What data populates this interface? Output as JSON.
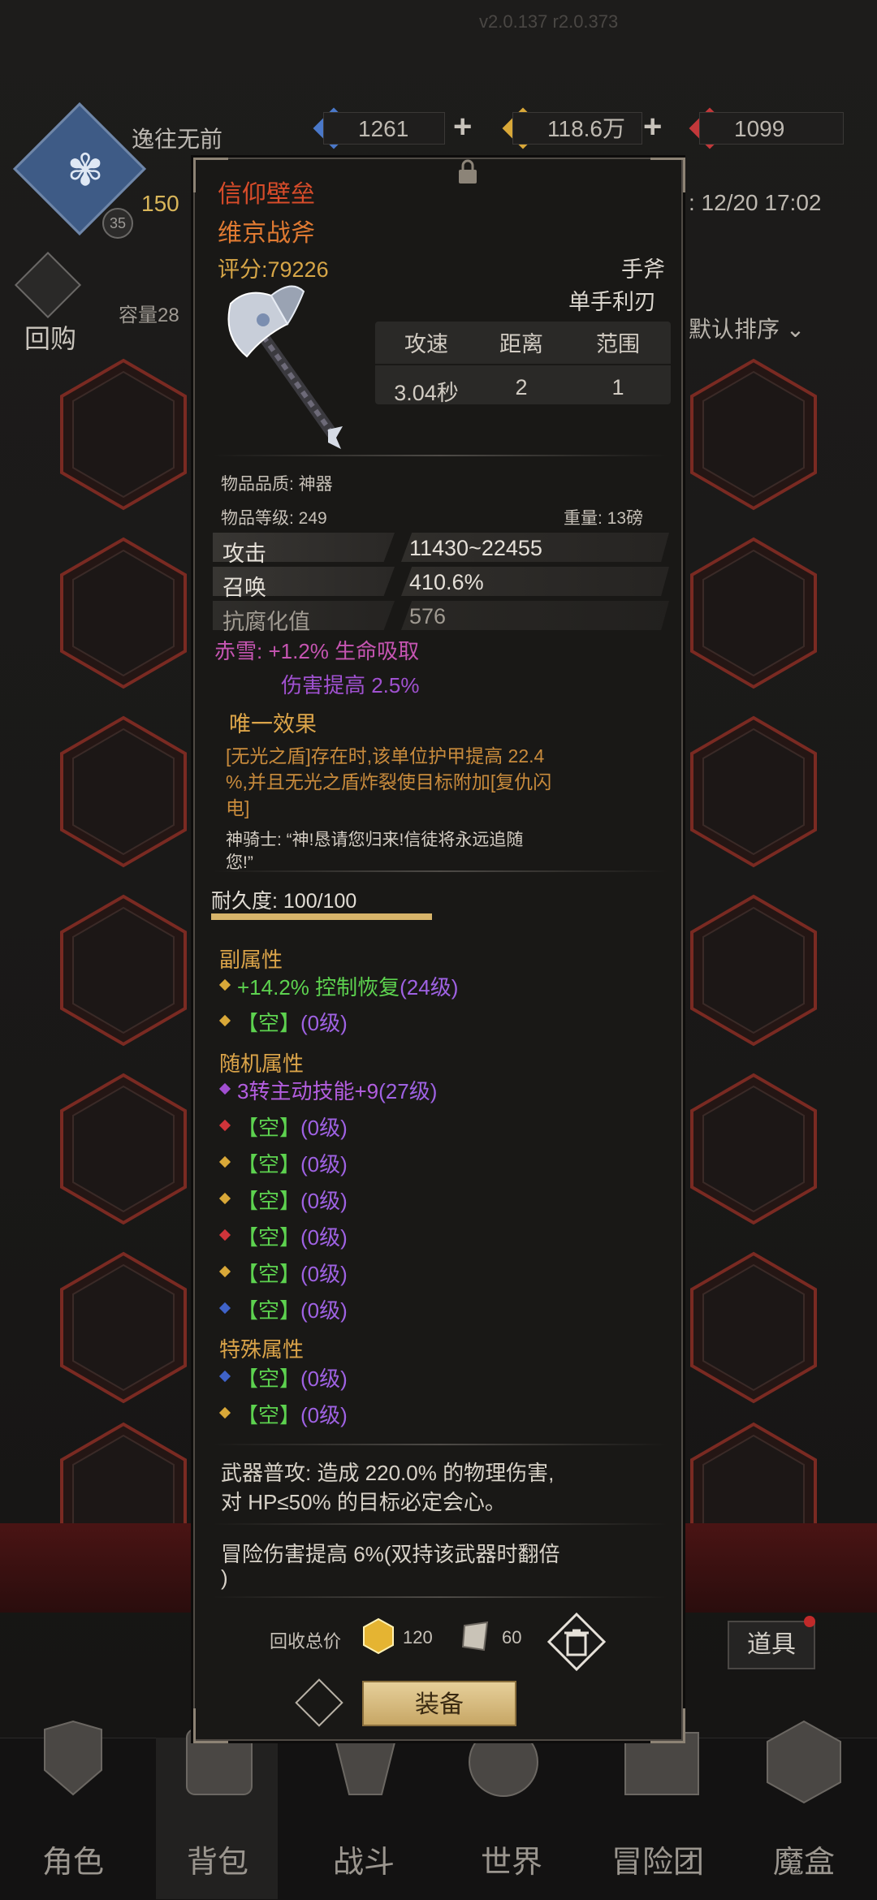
{
  "version": "v2.0.137 r2.0.373",
  "player": {
    "name": "逸往无前",
    "level": "35",
    "exp_text": "150",
    "time": ": 12/20 17:02"
  },
  "currencies": [
    {
      "name": "blue-gem",
      "value": "1261",
      "color": "#4a78c9"
    },
    {
      "name": "gold-gem",
      "value": "118.6万",
      "color": "#d9a838"
    },
    {
      "name": "red-gem",
      "value": "1099",
      "color": "#c2383a"
    }
  ],
  "inventory": {
    "recycle_label": "回购",
    "capacity": "容量28",
    "sort_label": "默认排序"
  },
  "popup": {
    "set_name": "信仰壁垒",
    "item_name": "维京战斧",
    "score": "评分:79226",
    "type1": "手斧",
    "type2": "单手利刃",
    "stats_headers": [
      "攻速",
      "距离",
      "范围"
    ],
    "stats_values": [
      "3.04秒",
      "2",
      "1"
    ],
    "quality": "物品品质: 神器",
    "item_level": "物品等级: 249",
    "weight": "重量: 13磅",
    "attributes": [
      {
        "name": "攻击",
        "value": "11430~22455"
      },
      {
        "name": "召唤",
        "value": "410.6%"
      },
      {
        "name": "抗腐化值",
        "value": "576"
      }
    ],
    "set_bonus_line1": "赤雪: +1.2% 生命吸取",
    "set_bonus_line2": "伤害提高 2.5%",
    "unique_title": "唯一效果",
    "unique_desc1": "[无光之盾]存在时,该单位护甲提高 22.4",
    "unique_desc2": "%,并且无光之盾炸裂使目标附加[复仇闪",
    "unique_desc3": "电]",
    "flavor1": "神骑士: “神!恳请您归来!信徒将永远追随",
    "flavor2": "您!”",
    "durability": "耐久度: 100/100",
    "durability_fraction": 1.0,
    "sub_title": "副属性",
    "sub_attrs": [
      {
        "text": "+14.2% 控制恢复",
        "level": "(24级)",
        "gem": "#d9a838"
      },
      {
        "text": "【空】",
        "level": "(0级)",
        "gem": "#d9a838"
      }
    ],
    "random_title": "随机属性",
    "random_attrs": [
      {
        "text": "3转主动技能+9",
        "level": "(27级)",
        "gem": "#a14fd1"
      },
      {
        "text": "【空】",
        "level": "(0级)",
        "gem": "#d0343a"
      },
      {
        "text": "【空】",
        "level": "(0级)",
        "gem": "#d9a838"
      },
      {
        "text": "【空】",
        "level": "(0级)",
        "gem": "#d9a838"
      },
      {
        "text": "【空】",
        "level": "(0级)",
        "gem": "#d0343a"
      },
      {
        "text": "【空】",
        "level": "(0级)",
        "gem": "#d9a838"
      },
      {
        "text": "【空】",
        "level": "(0级)",
        "gem": "#3f63c9"
      }
    ],
    "special_title": "特殊属性",
    "special_attrs": [
      {
        "text": "【空】",
        "level": "(0级)",
        "gem": "#3f63c9"
      },
      {
        "text": "【空】",
        "level": "(0级)",
        "gem": "#d9a838"
      }
    ],
    "weapon_desc1": "武器普攻: 造成 220.0% 的物理伤害,",
    "weapon_desc2": "对 HP≤50% 的目标必定会心。",
    "adventure1": "冒险伤害提高 6%(双持该武器时翻倍",
    "adventure2": ")",
    "recycle_label": "回收总价",
    "recycle_gold": "120",
    "recycle_scroll": "60",
    "equip_label": "装备"
  },
  "right_buttons": {
    "items_label": "道具"
  },
  "nav": [
    "角色",
    "背包",
    "战斗",
    "世界",
    "冒险团",
    "魔盒"
  ]
}
